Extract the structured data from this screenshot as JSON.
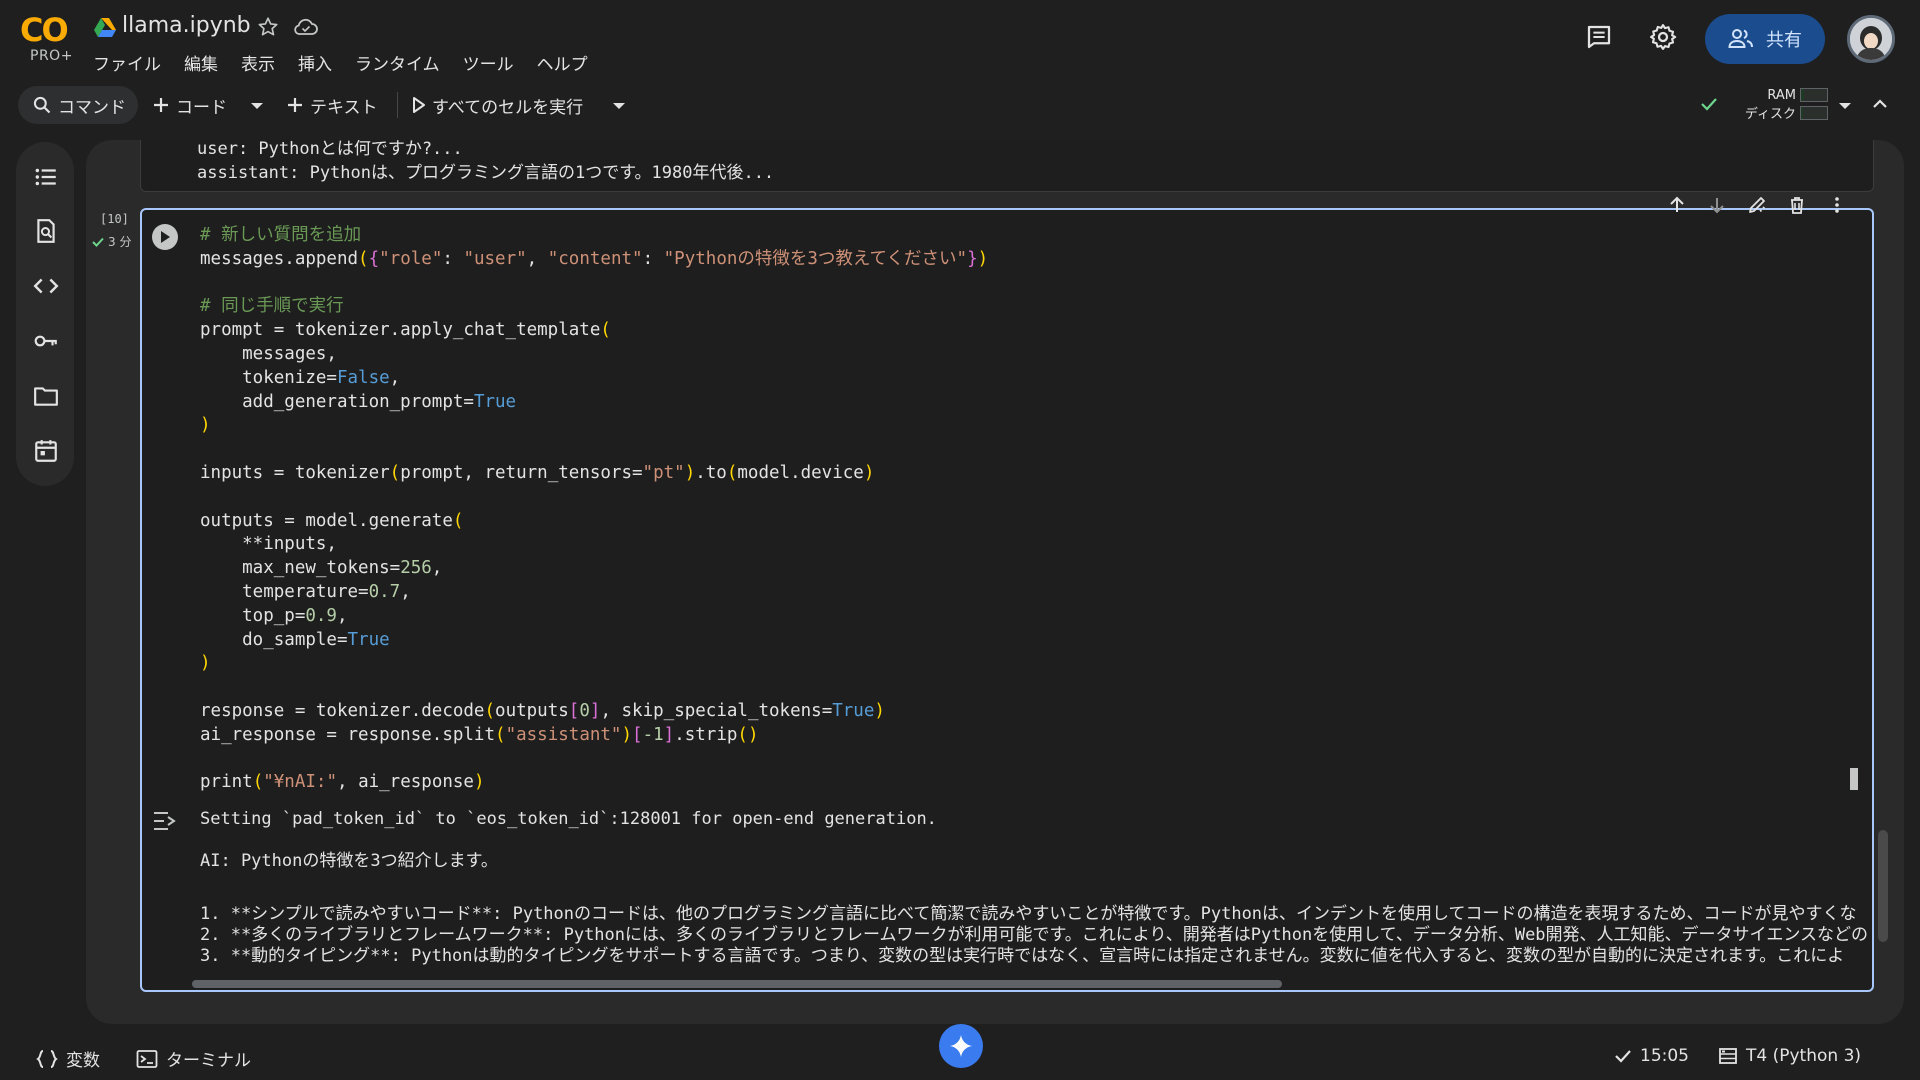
{
  "header": {
    "logo_text": "CO",
    "logo_sub": "PRO+",
    "notebook_title": "llama.ipynb",
    "menus": [
      "ファイル",
      "編集",
      "表示",
      "挿入",
      "ランタイム",
      "ツール",
      "ヘルプ"
    ],
    "share_label": "共有"
  },
  "toolbar": {
    "command_label": "コマンド",
    "code_label": "コード",
    "text_label": "テキスト",
    "run_all_label": "すべてのセルを実行",
    "ram_label": "RAM",
    "disk_label": "ディスク",
    "ram_usage": 0.12,
    "disk_usage": 0.08
  },
  "previous_output": {
    "line1": "user: Pythonとは何ですか?...",
    "line2": "assistant: Pythonは、プログラミング言語の1つです。1980年代後..."
  },
  "cell": {
    "execution_count": "[10]",
    "duration": "3 分",
    "code_lines": [
      [
        {
          "t": "# 新しい質問を追加",
          "c": "com"
        }
      ],
      [
        {
          "t": "messages.append"
        },
        {
          "t": "(",
          "c": "br"
        },
        {
          "t": "{",
          "c": "br2"
        },
        {
          "t": "\"role\"",
          "c": "str"
        },
        {
          "t": ": "
        },
        {
          "t": "\"user\"",
          "c": "str"
        },
        {
          "t": ", "
        },
        {
          "t": "\"content\"",
          "c": "str"
        },
        {
          "t": ": "
        },
        {
          "t": "\"Pythonの特徴を3つ教えてください\"",
          "c": "str"
        },
        {
          "t": "}",
          "c": "br2"
        },
        {
          "t": ")",
          "c": "br"
        }
      ],
      [
        {
          "t": ""
        }
      ],
      [
        {
          "t": "# 同じ手順で実行",
          "c": "com"
        }
      ],
      [
        {
          "t": "prompt = tokenizer.apply_chat_template"
        },
        {
          "t": "(",
          "c": "br"
        }
      ],
      [
        {
          "t": "    messages,"
        }
      ],
      [
        {
          "t": "    tokenize="
        },
        {
          "t": "False",
          "c": "kw"
        },
        {
          "t": ","
        }
      ],
      [
        {
          "t": "    add_generation_prompt="
        },
        {
          "t": "True",
          "c": "kw"
        }
      ],
      [
        {
          "t": ")",
          "c": "br"
        }
      ],
      [
        {
          "t": ""
        }
      ],
      [
        {
          "t": "inputs = tokenizer"
        },
        {
          "t": "(",
          "c": "br"
        },
        {
          "t": "prompt, return_tensors="
        },
        {
          "t": "\"pt\"",
          "c": "str"
        },
        {
          "t": ")",
          "c": "br"
        },
        {
          "t": ".to"
        },
        {
          "t": "(",
          "c": "br"
        },
        {
          "t": "model.device"
        },
        {
          "t": ")",
          "c": "br"
        }
      ],
      [
        {
          "t": ""
        }
      ],
      [
        {
          "t": "outputs = model.generate"
        },
        {
          "t": "(",
          "c": "br"
        }
      ],
      [
        {
          "t": "    **inputs,"
        }
      ],
      [
        {
          "t": "    max_new_tokens="
        },
        {
          "t": "256",
          "c": "num"
        },
        {
          "t": ","
        }
      ],
      [
        {
          "t": "    temperature="
        },
        {
          "t": "0.7",
          "c": "num"
        },
        {
          "t": ","
        }
      ],
      [
        {
          "t": "    top_p="
        },
        {
          "t": "0.9",
          "c": "num"
        },
        {
          "t": ","
        }
      ],
      [
        {
          "t": "    do_sample="
        },
        {
          "t": "True",
          "c": "kw"
        }
      ],
      [
        {
          "t": ")",
          "c": "br"
        }
      ],
      [
        {
          "t": ""
        }
      ],
      [
        {
          "t": "response = tokenizer.decode"
        },
        {
          "t": "(",
          "c": "br"
        },
        {
          "t": "outputs"
        },
        {
          "t": "[",
          "c": "br2"
        },
        {
          "t": "0",
          "c": "num"
        },
        {
          "t": "]",
          "c": "br2"
        },
        {
          "t": ", skip_special_tokens="
        },
        {
          "t": "True",
          "c": "kw"
        },
        {
          "t": ")",
          "c": "br"
        }
      ],
      [
        {
          "t": "ai_response = response.split"
        },
        {
          "t": "(",
          "c": "br"
        },
        {
          "t": "\"assistant\"",
          "c": "str"
        },
        {
          "t": ")",
          "c": "br"
        },
        {
          "t": "[",
          "c": "br2"
        },
        {
          "t": "-1",
          "c": "num"
        },
        {
          "t": "]",
          "c": "br2"
        },
        {
          "t": ".strip"
        },
        {
          "t": "()",
          "c": "br"
        }
      ],
      [
        {
          "t": ""
        }
      ],
      [
        {
          "t": "print"
        },
        {
          "t": "(",
          "c": "br"
        },
        {
          "t": "\"¥nAI:\"",
          "c": "str"
        },
        {
          "t": ", ai_response"
        },
        {
          "t": ")",
          "c": "br"
        }
      ]
    ],
    "output_line1": "Setting `pad_token_id` to `eos_token_id`:128001 for open-end generation.",
    "output_line2": "AI: Pythonの特徴を3つ紹介します。",
    "output_items": [
      "1.  **シンプルで読みやすいコード**: Pythonのコードは、他のプログラミング言語に比べて簡潔で読みやすいことが特徴です。Pythonは、インデントを使用してコードの構造を表現するため、コードが見やすくな",
      "2.  **多くのライブラリとフレームワーク**: Pythonには、多くのライブラリとフレームワークが利用可能です。これにより、開発者はPythonを使用して、データ分析、Web開発、人工知能、データサイエンスなどの",
      "3.  **動的タイピング**: Pythonは動的タイピングをサポートする言語です。つまり、変数の型は実行時ではなく、宣言時には指定されません。変数に値を代入すると、変数の型が自動的に決定されます。これによ"
    ]
  },
  "statusbar": {
    "variables_label": "変数",
    "terminal_label": "ターミナル",
    "time": "15:05",
    "runtime": "T4 (Python 3)"
  },
  "colors": {
    "background": "#1f1f1f",
    "cell_border": "#a8c7fa",
    "share_button": "#1a4c8e",
    "gemini_button": "#3a7bf0",
    "check": "#6dd58c"
  }
}
